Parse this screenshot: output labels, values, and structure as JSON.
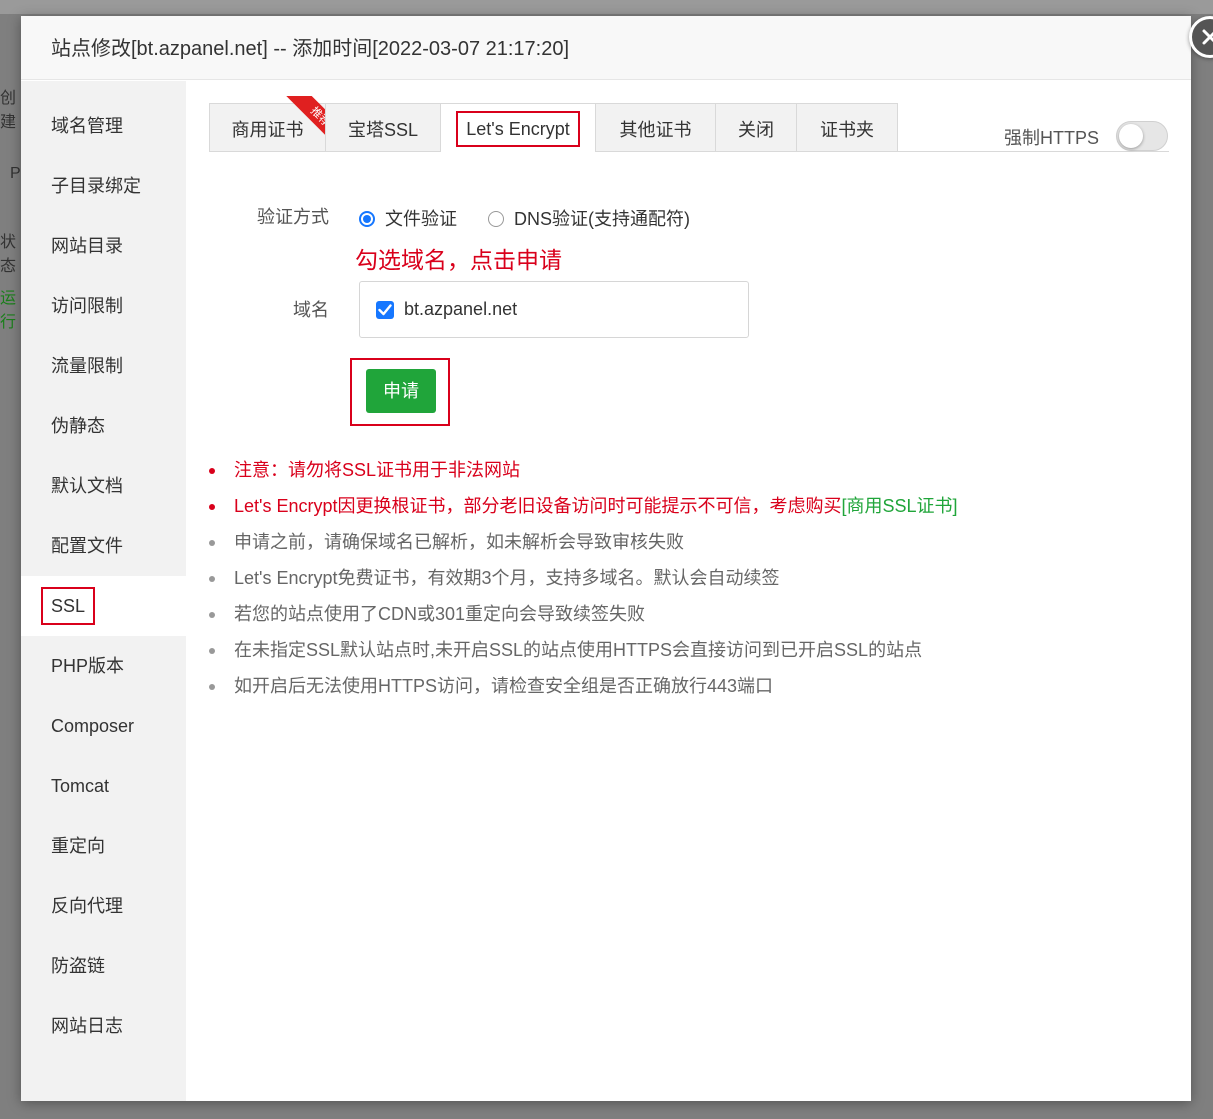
{
  "background": {
    "fragments": [
      "创建",
      "P",
      "状态",
      "运行"
    ]
  },
  "dialog": {
    "title": "站点修改[bt.azpanel.net] -- 添加时间[2022-03-07 21:17:20]"
  },
  "sidebar": {
    "items": [
      {
        "label": "域名管理"
      },
      {
        "label": "子目录绑定"
      },
      {
        "label": "网站目录"
      },
      {
        "label": "访问限制"
      },
      {
        "label": "流量限制"
      },
      {
        "label": "伪静态"
      },
      {
        "label": "默认文档"
      },
      {
        "label": "配置文件"
      },
      {
        "label": "SSL"
      },
      {
        "label": "PHP版本"
      },
      {
        "label": "Composer"
      },
      {
        "label": "Tomcat"
      },
      {
        "label": "重定向"
      },
      {
        "label": "反向代理"
      },
      {
        "label": "防盗链"
      },
      {
        "label": "网站日志"
      }
    ],
    "active": "SSL"
  },
  "tabs": {
    "items": [
      {
        "label": "商用证书",
        "badge": "推荐"
      },
      {
        "label": "宝塔SSL"
      },
      {
        "label": "Let's Encrypt"
      },
      {
        "label": "其他证书"
      },
      {
        "label": "关闭"
      },
      {
        "label": "证书夹"
      }
    ],
    "active": "Let's Encrypt"
  },
  "https_toggle": {
    "label": "强制HTTPS",
    "enabled": false
  },
  "form": {
    "verify_label": "验证方式",
    "verify_options": [
      {
        "label": "文件验证",
        "checked": true
      },
      {
        "label": "DNS验证(支持通配符)",
        "checked": false
      }
    ],
    "hint": "勾选域名，点击申请",
    "domain_label": "域名",
    "domain_value": "bt.azpanel.net",
    "domain_checked": true,
    "apply_label": "申请"
  },
  "notes": {
    "items": [
      {
        "text": "注意：请勿将SSL证书用于非法网站",
        "color": "#d9001b"
      },
      {
        "text": "Let's Encrypt因更换根证书，部分老旧设备访问时可能提示不可信，考虑购买",
        "link": "[商用SSL证书]",
        "color": "#d9001b",
        "link_color": "#20a53a"
      },
      {
        "text": "申请之前，请确保域名已解析，如未解析会导致审核失败"
      },
      {
        "text": "Let's Encrypt免费证书，有效期3个月，支持多域名。默认会自动续签"
      },
      {
        "text": "若您的站点使用了CDN或301重定向会导致续签失败"
      },
      {
        "text": "在未指定SSL默认站点时,未开启SSL的站点使用HTTPS会直接访问到已开启SSL的站点"
      },
      {
        "text": "如开启后无法使用HTTPS访问，请检查安全组是否正确放行443端口"
      }
    ]
  },
  "colors": {
    "accent_red": "#d9001b",
    "primary_green": "#20a53a",
    "radio_blue": "#1677ff"
  }
}
